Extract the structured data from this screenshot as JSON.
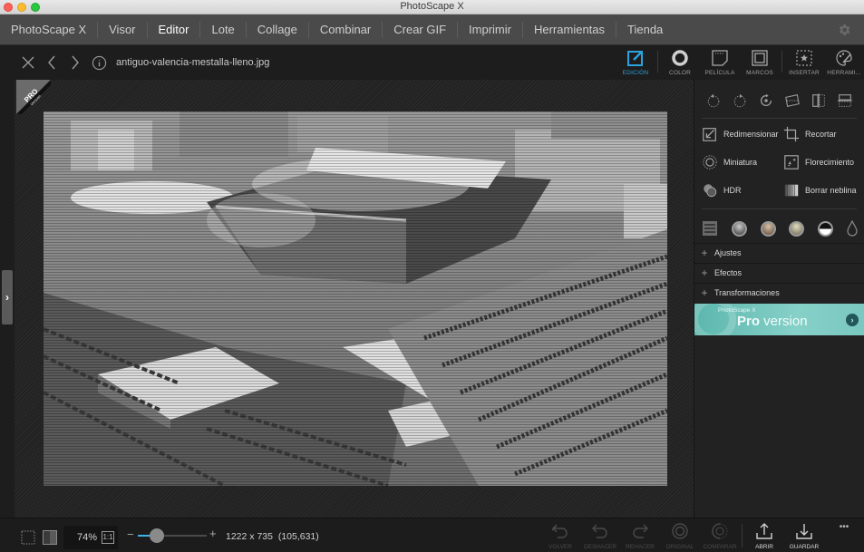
{
  "window": {
    "title": "PhotoScape X"
  },
  "menu": {
    "items": [
      {
        "label": "PhotoScape X"
      },
      {
        "label": "Visor"
      },
      {
        "label": "Editor",
        "active": true
      },
      {
        "label": "Lote"
      },
      {
        "label": "Collage"
      },
      {
        "label": "Combinar"
      },
      {
        "label": "Crear GIF"
      },
      {
        "label": "Imprimir"
      },
      {
        "label": "Herramientas"
      },
      {
        "label": "Tienda"
      }
    ],
    "settings_icon": "gear-icon"
  },
  "toolbar": {
    "filename": "antiguo-valencia-mestalla-lleno.jpg",
    "nav_icons": [
      "close-icon",
      "chevron-left-icon",
      "chevron-right-icon",
      "info-icon"
    ],
    "tabs": [
      {
        "label": "EDICIÓN",
        "icon": "edit-icon",
        "active": true
      },
      {
        "label": "COLOR",
        "icon": "color-ring-icon"
      },
      {
        "label": "PELÍCULA",
        "icon": "film-icon"
      },
      {
        "label": "MARCOS",
        "icon": "frame-icon"
      },
      {
        "label": "INSERTAR",
        "icon": "insert-star-icon"
      },
      {
        "label": "HERRAMI...",
        "icon": "palette-icon"
      }
    ],
    "accent_color": "#2ba3e0"
  },
  "canvas": {
    "pro_badge": {
      "title": "PRO",
      "subtitle": "Version"
    },
    "image_description": "Black and white aerial photo of old Mestalla stadium in Valencia"
  },
  "side_panel": {
    "rotate_icons": [
      "rotate-left-icon",
      "rotate-right-icon",
      "rotate-free-icon",
      "straighten-icon",
      "flip-horizontal-icon",
      "flip-vertical-icon"
    ],
    "tools": [
      {
        "label": "Redimensionar",
        "icon": "resize-icon"
      },
      {
        "label": "Recortar",
        "icon": "crop-icon"
      },
      {
        "label": "Miniatura",
        "icon": "miniature-icon"
      },
      {
        "label": "Florecimiento",
        "icon": "bloom-icon"
      },
      {
        "label": "HDR",
        "icon": "hdr-icon"
      },
      {
        "label": "Borrar neblina",
        "icon": "dehaze-icon"
      }
    ],
    "swatch_icons": [
      "list-icon",
      "grayscale-icon",
      "sepia-icon",
      "vintage-icon",
      "bw-contrast-icon",
      "drop-icon"
    ],
    "sections": [
      {
        "label": "Ajustes"
      },
      {
        "label": "Efectos"
      },
      {
        "label": "Transformaciones"
      }
    ],
    "promo": {
      "small": "PhotoScape X",
      "big_bold": "Pro",
      "big_light": " version"
    }
  },
  "bottom_bar": {
    "zoom_percent": "74%",
    "one_to_one": "1:1",
    "zoom_slider_fraction": 0.28,
    "image_dims": "1222 x 735",
    "cursor_coords": "(105,631)",
    "actions": [
      {
        "label": "VOLVER",
        "enabled": false
      },
      {
        "label": "DESHACER",
        "enabled": false
      },
      {
        "label": "REHACER",
        "enabled": false
      },
      {
        "label": "ORIGINAL",
        "enabled": false
      },
      {
        "label": "COMPARAR",
        "enabled": false
      },
      {
        "label": "ABRIR",
        "enabled": true
      },
      {
        "label": "GUARDAR",
        "enabled": true
      }
    ],
    "more_label": "•••"
  }
}
